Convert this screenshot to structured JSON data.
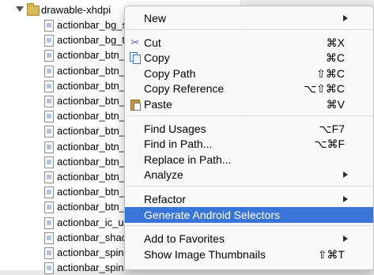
{
  "tree": {
    "folder": {
      "label": "drawable-xhdpi"
    },
    "files": [
      "actionbar_bg_s",
      "actionbar_bg_t",
      "actionbar_btn_",
      "actionbar_btn_",
      "actionbar_btn_",
      "actionbar_btn_",
      "actionbar_btn_",
      "actionbar_btn_",
      "actionbar_btn_",
      "actionbar_btn_",
      "actionbar_btn_",
      "actionbar_btn_",
      "actionbar_btn_",
      "actionbar_ic_u",
      "actionbar_shac",
      "actionbar_spin",
      "actionbar_spin"
    ]
  },
  "context_menu": {
    "items": [
      {
        "label": "New",
        "shortcut": "",
        "submenu": true,
        "icon": ""
      },
      {
        "separator": true
      },
      {
        "label": "Cut",
        "shortcut": "⌘X",
        "submenu": false,
        "icon": "scissors-icon"
      },
      {
        "label": "Copy",
        "shortcut": "⌘C",
        "submenu": false,
        "icon": "copy-icon"
      },
      {
        "label": "Copy Path",
        "shortcut": "⇧⌘C",
        "submenu": false,
        "icon": ""
      },
      {
        "label": "Copy Reference",
        "shortcut": "⌥⇧⌘C",
        "submenu": false,
        "icon": ""
      },
      {
        "label": "Paste",
        "shortcut": "⌘V",
        "submenu": false,
        "icon": "paste-icon"
      },
      {
        "separator": true
      },
      {
        "label": "Find Usages",
        "shortcut": "⌥F7",
        "submenu": false,
        "icon": ""
      },
      {
        "label": "Find in Path...",
        "shortcut": "⌥⌘F",
        "submenu": false,
        "icon": ""
      },
      {
        "label": "Replace in Path...",
        "shortcut": "",
        "submenu": false,
        "icon": ""
      },
      {
        "label": "Analyze",
        "shortcut": "",
        "submenu": true,
        "icon": ""
      },
      {
        "separator": true
      },
      {
        "label": "Refactor",
        "shortcut": "",
        "submenu": true,
        "icon": ""
      },
      {
        "label": "Generate Android Selectors",
        "shortcut": "",
        "submenu": false,
        "icon": "",
        "highlighted": true
      },
      {
        "separator": true
      },
      {
        "label": "Add to Favorites",
        "shortcut": "",
        "submenu": true,
        "icon": ""
      },
      {
        "label": "Show Image Thumbnails",
        "shortcut": "⇧⌘T",
        "submenu": false,
        "icon": ""
      }
    ]
  },
  "colors": {
    "highlight": "#3875d7",
    "folder": "#d9b85a",
    "scissors": "#6c4fb3"
  }
}
